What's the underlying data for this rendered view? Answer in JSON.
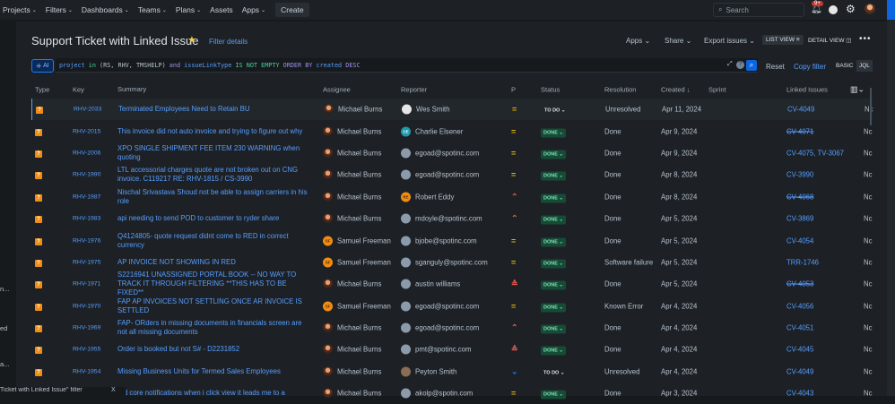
{
  "nav": {
    "items": [
      {
        "label": "Projects",
        "dd": true
      },
      {
        "label": "Filters",
        "dd": true
      },
      {
        "label": "Dashboards",
        "dd": true
      },
      {
        "label": "Teams",
        "dd": true
      },
      {
        "label": "Plans",
        "dd": true
      },
      {
        "label": "Assets",
        "dd": false
      },
      {
        "label": "Apps",
        "dd": true
      }
    ],
    "create": "Create",
    "search_placeholder": "Search",
    "notif_badge": "9+"
  },
  "header": {
    "title": "Support Ticket with Linked Issue",
    "filter_details": "Filter details",
    "apps": "Apps",
    "share": "Share",
    "export": "Export issues",
    "list_view": "LIST VIEW",
    "detail_view": "DETAIL VIEW"
  },
  "jql": {
    "ai": "AI",
    "tokens": [
      {
        "t": "project",
        "c": "fld"
      },
      {
        "t": " in ",
        "c": "op"
      },
      {
        "t": "(RS, RHV, TMSHELP) ",
        "c": "val"
      },
      {
        "t": "and ",
        "c": "kw"
      },
      {
        "t": "issueLinkType",
        "c": "fld"
      },
      {
        "t": " IS NOT EMPTY ",
        "c": "op"
      },
      {
        "t": "ORDER BY ",
        "c": "kw"
      },
      {
        "t": "created ",
        "c": "fld"
      },
      {
        "t": "DESC",
        "c": "kw"
      }
    ],
    "reset": "Reset",
    "copy": "Copy filter",
    "basic": "BASIC",
    "jql": "JQL"
  },
  "columns": {
    "type": "Type",
    "key": "Key",
    "summary": "Summary",
    "assignee": "Assignee",
    "reporter": "Reporter",
    "p": "P",
    "status": "Status",
    "resolution": "Resolution",
    "created": "Created ↓",
    "sprint": "Sprint",
    "linked": "Linked Issues"
  },
  "colors": {
    "medium": "#e2b203",
    "high": "#f15b50",
    "low": "#1d7afc"
  },
  "rows": [
    {
      "key": "RHV-2033",
      "summary": "Terminated Employees Need to Retain BU",
      "assignee": "Michael Burns",
      "av": "mb",
      "reporter": "Wes Smith",
      "rav": "ws",
      "rinit": "",
      "priority": "medium",
      "status": "TO DO",
      "resolution": "Unresolved",
      "created": "Apr 11, 2024",
      "linked": "CV-4049",
      "strike": false,
      "extra": "Nc"
    },
    {
      "key": "RHV-2015",
      "summary": "This invoice did not auto invoice and trying to figure out why",
      "assignee": "Michael Burns",
      "av": "mb",
      "reporter": "Charlie Elsener",
      "rav": "ce",
      "rinit": "CE",
      "priority": "medium",
      "status": "DONE",
      "resolution": "Done",
      "created": "Apr 9, 2024",
      "linked": "CV-4071",
      "strike": true,
      "extra": "Nc"
    },
    {
      "key": "RHV-2006",
      "summary": "XPO SINGLE SHIPMENT FEE ITEM 230 WARNING when quoting",
      "assignee": "Michael Burns",
      "av": "mb",
      "reporter": "egoad@spotinc.com",
      "rav": "def",
      "rinit": "",
      "priority": "medium",
      "status": "DONE",
      "resolution": "Done",
      "created": "Apr 9, 2024",
      "linked": "CV-4075, TV-3067",
      "strike": false,
      "extra": "Nc"
    },
    {
      "key": "RHV-1990",
      "summary": "LTL accessorial charges quote are not broken out on CNG invoice. C119217 RE: RHV-1815 / CS-3990",
      "assignee": "Michael Burns",
      "av": "mb",
      "reporter": "egoad@spotinc.com",
      "rav": "def",
      "rinit": "",
      "priority": "medium",
      "status": "DONE",
      "resolution": "Done",
      "created": "Apr 8, 2024",
      "linked": "CV-3990",
      "strike": false,
      "extra": "Nc"
    },
    {
      "key": "RHV-1987",
      "summary": "Nischal Srivastava Shoud not be able to assign carriers in his role",
      "assignee": "Michael Burns",
      "av": "mb",
      "reporter": "Robert Eddy",
      "rav": "re",
      "rinit": "RE",
      "priority": "high",
      "status": "DONE",
      "resolution": "Done",
      "created": "Apr 8, 2024",
      "linked": "CV-4068",
      "strike": true,
      "extra": "Nc"
    },
    {
      "key": "RHV-1983",
      "summary": "api needing to send POD to customer to ryder share",
      "assignee": "Michael Burns",
      "av": "mb",
      "reporter": "mdoyle@spotinc.com",
      "rav": "def",
      "rinit": "",
      "priority": "high",
      "status": "DONE",
      "resolution": "Done",
      "created": "Apr 5, 2024",
      "linked": "CV-3869",
      "strike": false,
      "extra": "Nc"
    },
    {
      "key": "RHV-1976",
      "summary": "Q4124805- quote request didnt come to RED in correct currency",
      "assignee": "Samuel Freeman",
      "av": "sf",
      "reporter": "bjobe@spotinc.com",
      "rav": "def",
      "rinit": "",
      "priority": "medium",
      "status": "DONE",
      "resolution": "Done",
      "created": "Apr 5, 2024",
      "linked": "CV-4054",
      "strike": false,
      "extra": "Nc"
    },
    {
      "key": "RHV-1975",
      "summary": "AP INVOICE NOT SHOWING IN RED",
      "assignee": "Samuel Freeman",
      "av": "sf",
      "reporter": "sganguly@spotinc.com",
      "rav": "def",
      "rinit": "",
      "priority": "medium",
      "status": "DONE",
      "resolution": "Software failure",
      "created": "Apr 5, 2024",
      "linked": "TRR-1746",
      "strike": false,
      "extra": "Nc"
    },
    {
      "key": "RHV-1971",
      "summary": "S2216941 UNASSIGNED PORTAL BOOK -- NO WAY TO TRACK IT THROUGH FILTERING **THIS HAS TO BE FIXED**",
      "assignee": "Michael Burns",
      "av": "mb",
      "reporter": "austin williams",
      "rav": "def",
      "rinit": "",
      "priority": "highest",
      "status": "DONE",
      "resolution": "Done",
      "created": "Apr 5, 2024",
      "linked": "CV-4053",
      "strike": true,
      "extra": "Nc"
    },
    {
      "key": "RHV-1970",
      "summary": "FAP AP INVOICES NOT SETTLING ONCE AR INVOICE IS SETTLED",
      "assignee": "Samuel Freeman",
      "av": "sf",
      "reporter": "egoad@spotinc.com",
      "rav": "def",
      "rinit": "",
      "priority": "medium",
      "status": "DONE",
      "resolution": "Known Error",
      "created": "Apr 4, 2024",
      "linked": "CV-4056",
      "strike": false,
      "extra": "Nc"
    },
    {
      "key": "RHV-1969",
      "summary": "FAP- ORders in missing documents in financials screen are not all missing documents",
      "assignee": "Michael Burns",
      "av": "mb",
      "reporter": "egoad@spotinc.com",
      "rav": "def",
      "rinit": "",
      "priority": "high",
      "status": "DONE",
      "resolution": "Done",
      "created": "Apr 4, 2024",
      "linked": "CV-4051",
      "strike": false,
      "extra": "Nc"
    },
    {
      "key": "RHV-1955",
      "summary": "Order is booked but not S# - D2231852",
      "assignee": "Michael Burns",
      "av": "mb",
      "reporter": "pmt@spotinc.com",
      "rav": "def",
      "rinit": "",
      "priority": "highest",
      "status": "DONE",
      "resolution": "Done",
      "created": "Apr 4, 2024",
      "linked": "CV-4045",
      "strike": false,
      "extra": "Nc"
    },
    {
      "key": "RHV-1954",
      "summary": "Missing Business Units for Termed Sales Employees",
      "assignee": "Michael Burns",
      "av": "mb",
      "reporter": "Peyton Smith",
      "rav": "ps",
      "rinit": "",
      "priority": "low",
      "status": "TO DO",
      "resolution": "Unresolved",
      "created": "Apr 4, 2024",
      "linked": "CV-4049",
      "strike": false,
      "extra": "Nc"
    },
    {
      "key": "",
      "summary": "red core notifications when i click view it leads me to a",
      "assignee": "Michael Burns",
      "av": "mb",
      "reporter": "akolp@spotin.com",
      "rav": "def",
      "rinit": "",
      "priority": "medium",
      "status": "DONE",
      "resolution": "Done",
      "created": "Apr 3, 2024",
      "linked": "CV-4043",
      "strike": false,
      "extra": "Nc"
    }
  ],
  "side_fragments": [
    "n...",
    "ed",
    "a..."
  ],
  "toast": {
    "text": "Ticket with Linked Issue\" filter",
    "close": "X"
  }
}
